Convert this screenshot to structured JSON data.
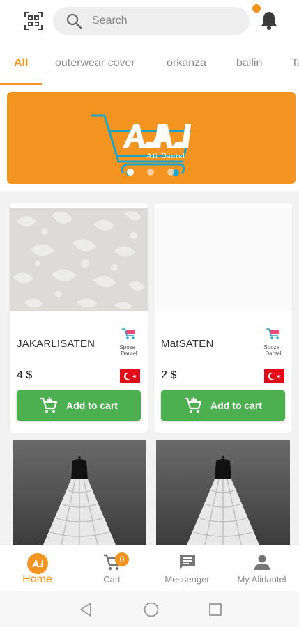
{
  "colors": {
    "accent": "#f39320",
    "green": "#4caf50",
    "flag_red": "#e30a17"
  },
  "header": {
    "scan_icon": "qr-scan-icon",
    "search_placeholder": "Search",
    "bell_icon": "bell-icon"
  },
  "tabs": [
    "All",
    "outerwear cover",
    "orkanza",
    "ballin",
    "Ta"
  ],
  "banner": {
    "logo_letters": "AJ",
    "logo_text": "Ali Dantel",
    "slides": 3,
    "active_slide": 0
  },
  "products": [
    {
      "name": "JAKARLISATEN",
      "vendor": "Spoza_ Dantel",
      "price": "4 $",
      "button": "Add to cart",
      "country": "Turkey"
    },
    {
      "name": "MatSATEN",
      "vendor": "Spoza_ Dantel",
      "price": "2 $",
      "button": "Add to cart",
      "country": "Turkey"
    }
  ],
  "bottom_nav": {
    "home": "Home",
    "cart": "Cart",
    "cart_count": "0",
    "messenger": "Messenger",
    "account": "My Alidantel"
  }
}
